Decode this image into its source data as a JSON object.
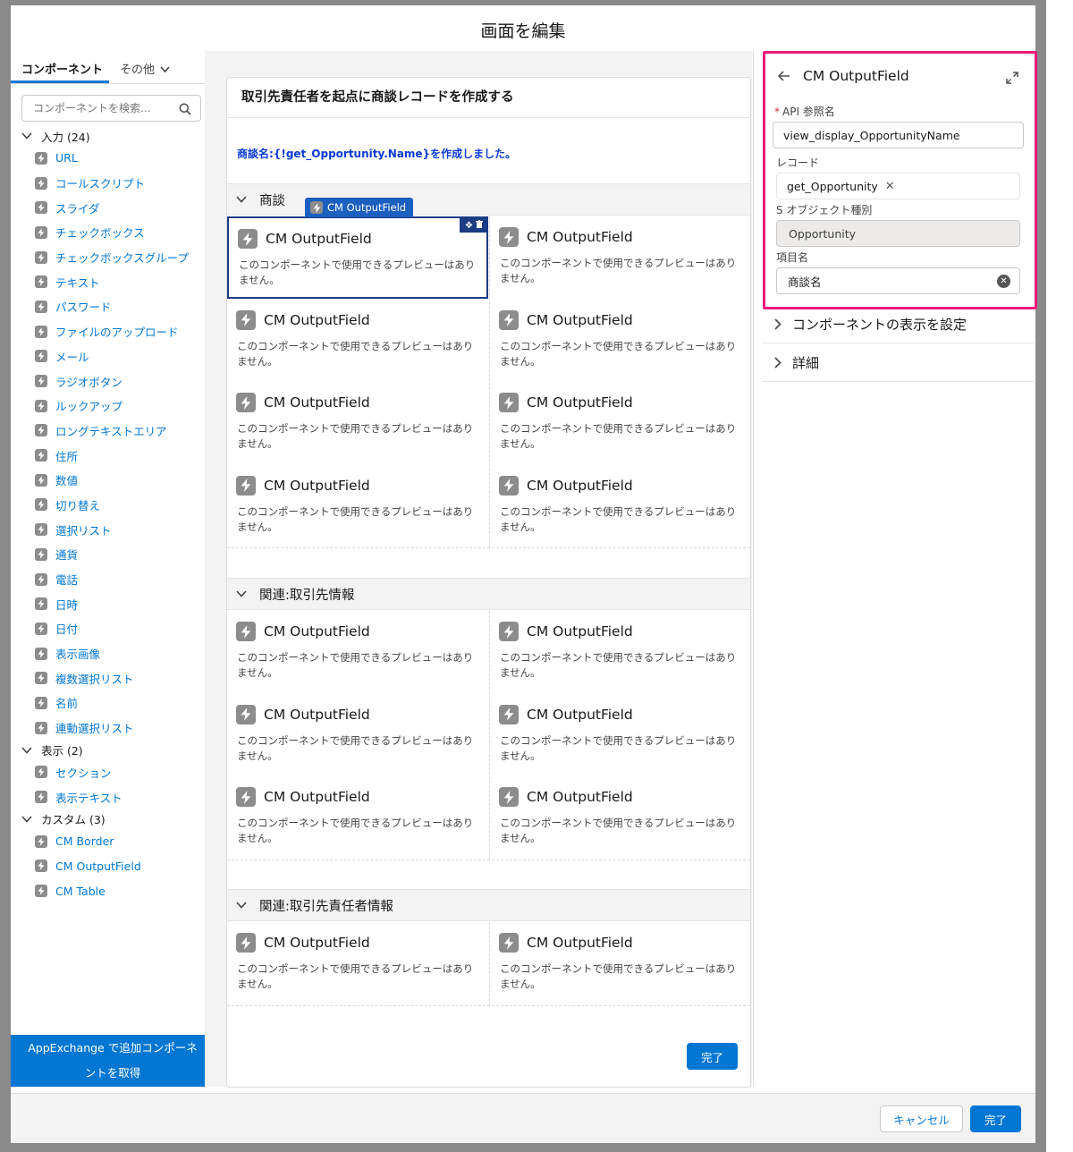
{
  "modal": {
    "title": "画面を編集"
  },
  "palette": {
    "tabs": {
      "components": "コンポーネント",
      "other": "その他"
    },
    "search_placeholder": "コンポーネントを検索...",
    "groups": [
      {
        "label": "入力 (24)",
        "items": [
          {
            "label": "URL",
            "icon": "link-icon"
          },
          {
            "label": "コールスクリプト",
            "icon": "bolt-icon"
          },
          {
            "label": "スライダ",
            "icon": "bolt-icon"
          },
          {
            "label": "チェックボックス",
            "icon": "checkbox-icon"
          },
          {
            "label": "チェックボックスグループ",
            "icon": "checkbox-group-icon"
          },
          {
            "label": "テキスト",
            "icon": "text-icon"
          },
          {
            "label": "パスワード",
            "icon": "password-icon"
          },
          {
            "label": "ファイルのアップロード",
            "icon": "bolt-icon"
          },
          {
            "label": "メール",
            "icon": "bolt-icon"
          },
          {
            "label": "ラジオボタン",
            "icon": "radio-icon"
          },
          {
            "label": "ルックアップ",
            "icon": "bolt-icon"
          },
          {
            "label": "ロングテキストエリア",
            "icon": "textarea-icon"
          },
          {
            "label": "住所",
            "icon": "bolt-icon"
          },
          {
            "label": "数値",
            "icon": "number-icon"
          },
          {
            "label": "切り替え",
            "icon": "bolt-icon"
          },
          {
            "label": "選択リスト",
            "icon": "list-icon"
          },
          {
            "label": "通貨",
            "icon": "currency-icon"
          },
          {
            "label": "電話",
            "icon": "bolt-icon"
          },
          {
            "label": "日時",
            "icon": "calendar-icon"
          },
          {
            "label": "日付",
            "icon": "calendar-icon"
          },
          {
            "label": "表示画像",
            "icon": "bolt-icon"
          },
          {
            "label": "複数選択リスト",
            "icon": "multiselect-icon"
          },
          {
            "label": "名前",
            "icon": "bolt-icon"
          },
          {
            "label": "連動選択リスト",
            "icon": "bolt-icon"
          }
        ]
      },
      {
        "label": "表示 (2)",
        "items": [
          {
            "label": "セクション",
            "icon": "section-icon"
          },
          {
            "label": "表示テキスト",
            "icon": "display-text-icon"
          }
        ]
      },
      {
        "label": "カスタム (3)",
        "items": [
          {
            "label": "CM Border",
            "icon": "bolt-icon"
          },
          {
            "label": "CM OutputField",
            "icon": "bolt-icon"
          },
          {
            "label": "CM Table",
            "icon": "bolt-icon"
          }
        ]
      }
    ],
    "appexchange_label": "AppExchange で追加コンポーネントを取得"
  },
  "canvas": {
    "screen_title": "取引先責任者を起点に商談レコードを作成する",
    "output_text": "商談名:{!get_Opportunity.Name}を作成しました。",
    "selected_label": "CM OutputField",
    "component_title": "CM OutputField",
    "component_desc": "このコンポーネントで使用できるプレビューはありません。",
    "sections": [
      {
        "title": "商談",
        "rows": 4
      },
      {
        "title": "関連:取引先情報",
        "rows": 3
      },
      {
        "title": "関連:取引先責任者情報",
        "rows": 1
      }
    ],
    "done_label": "完了"
  },
  "properties": {
    "title": "CM OutputField",
    "api_label": "API 参照名",
    "api_value": "view_display_OpportunityName",
    "record_label": "レコード",
    "record_value": "get_Opportunity",
    "sobject_label": "S オブジェクト種別",
    "sobject_value": "Opportunity",
    "field_label": "項目名",
    "field_value": "商談名",
    "accordion": [
      "コンポーネントの表示を設定",
      "詳細"
    ]
  },
  "footer": {
    "cancel_label": "キャンセル",
    "done_label": "完了"
  },
  "colors": {
    "brand": "#0176d3",
    "highlight": "#ea1a78",
    "selected": "#1b3c84",
    "merge_text": "#0b3bd6"
  }
}
